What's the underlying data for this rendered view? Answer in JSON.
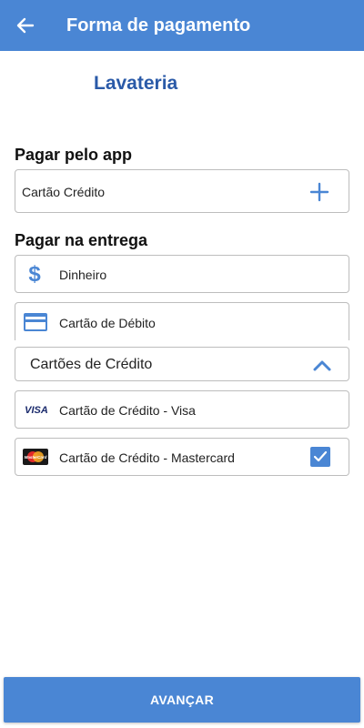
{
  "appbar": {
    "title": "Forma de pagamento",
    "back_icon": "arrow-left-icon"
  },
  "store": {
    "name": "Lavateria"
  },
  "pay_app": {
    "title": "Pagar pelo app",
    "card_label": "Cartão Crédito",
    "add_icon": "plus-icon"
  },
  "pay_delivery": {
    "title": "Pagar na entrega",
    "options": [
      {
        "label": "Dinheiro",
        "icon": "dollar-icon"
      },
      {
        "label": "Cartão de Débito",
        "icon": "debit-card-icon"
      }
    ],
    "credit_group": {
      "label": "Cartões de Crédito",
      "icon": "chevron-up-icon",
      "expanded": true,
      "items": [
        {
          "label": "Cartão de Crédito - Visa",
          "icon": "visa-icon",
          "brand_text": "VISA",
          "checked": false
        },
        {
          "label": "Cartão de Crédito - Mastercard",
          "icon": "mastercard-icon",
          "brand_text": "MasterCard",
          "checked": true
        }
      ]
    }
  },
  "footer": {
    "button_label": "AVANÇAR"
  },
  "colors": {
    "primary": "#4a86d4",
    "store_name": "#2a5aa8",
    "border": "#bdbdbd"
  }
}
